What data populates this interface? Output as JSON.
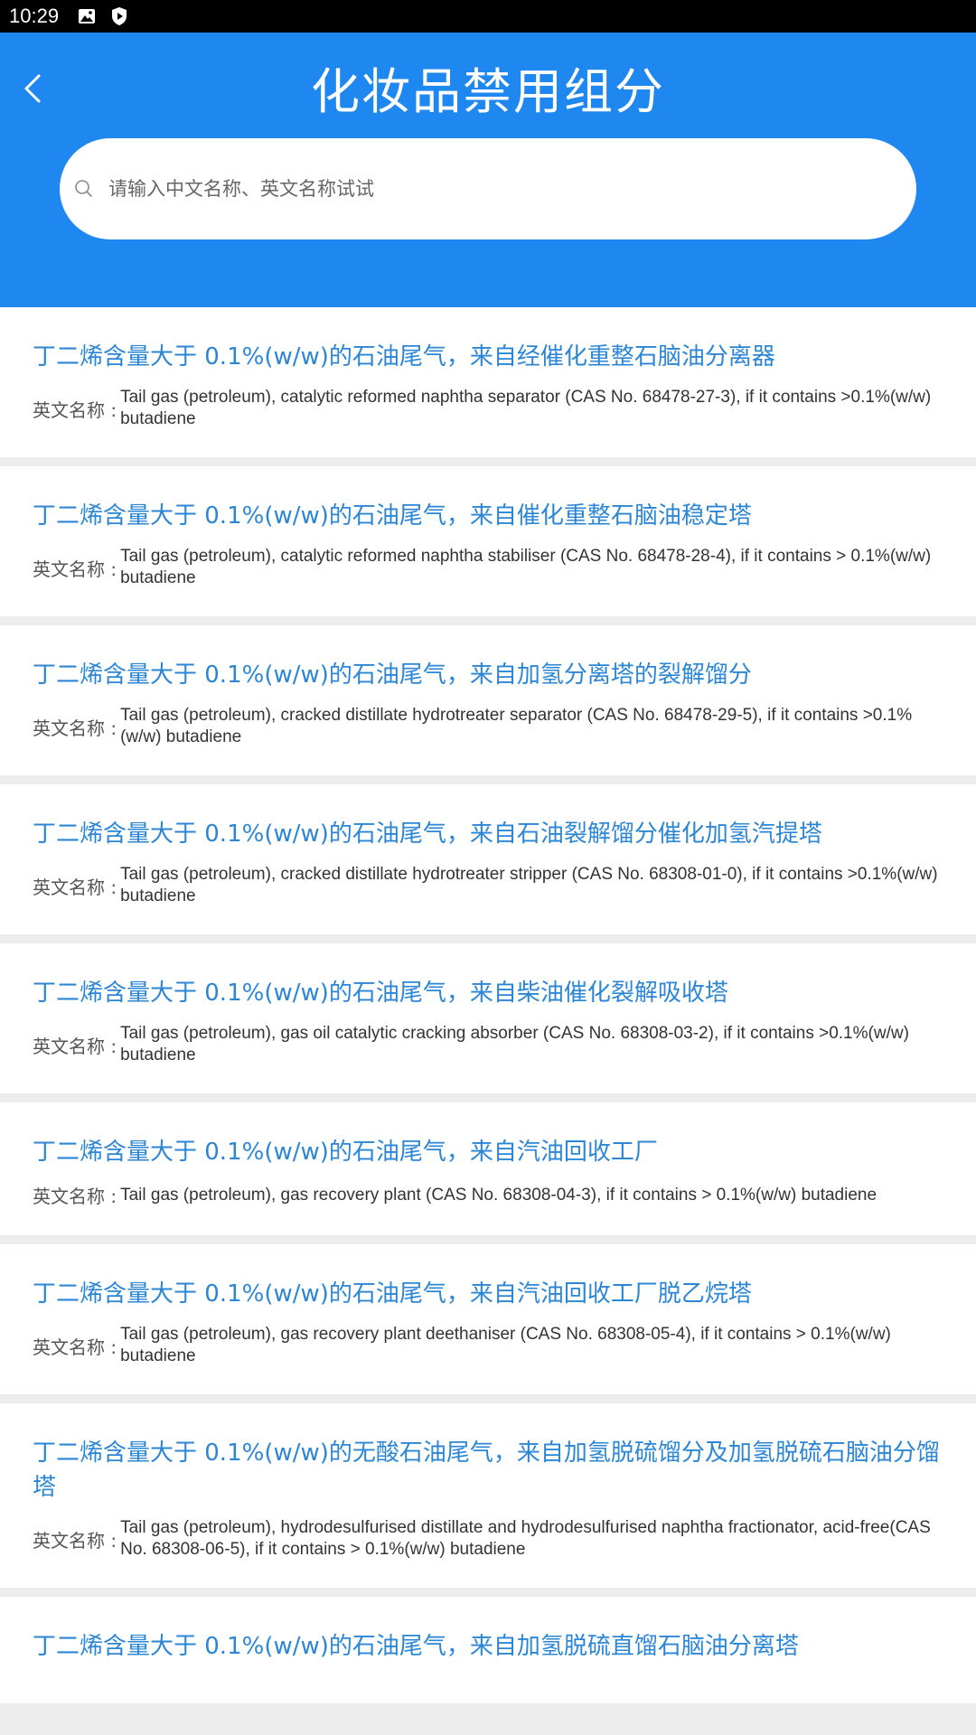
{
  "status_bar": {
    "time": "10:29",
    "icons": [
      "image-icon",
      "shield-play-icon"
    ]
  },
  "header": {
    "title": "化妆品禁用组分",
    "back_icon": "chevron-left-icon",
    "search": {
      "placeholder": "请输入中文名称、英文名称试试",
      "icon": "search-icon"
    }
  },
  "colors": {
    "primary": "#1e87f0",
    "title_link": "#2c86d6",
    "background": "#ededed"
  },
  "list": {
    "label": "英文名称 :",
    "items": [
      {
        "title": "丁二烯含量大于 0.1%(w/w)的石油尾气，来自经催化重整石脑油分离器",
        "english": "Tail gas (petroleum), catalytic reformed naphtha separator (CAS No. 68478-27-3), if it contains >0.1%(w/w) butadiene"
      },
      {
        "title": "丁二烯含量大于 0.1%(w/w)的石油尾气，来自催化重整石脑油稳定塔",
        "english": "Tail gas (petroleum), catalytic reformed naphtha stabiliser (CAS No. 68478-28-4), if it contains > 0.1%(w/w) butadiene"
      },
      {
        "title": "丁二烯含量大于 0.1%(w/w)的石油尾气，来自加氢分离塔的裂解馏分",
        "english": "Tail gas (petroleum), cracked distillate hydrotreater separator (CAS No. 68478-29-5), if it contains >0.1%(w/w) butadiene"
      },
      {
        "title": "丁二烯含量大于 0.1%(w/w)的石油尾气，来自石油裂解馏分催化加氢汽提塔",
        "english": "Tail gas (petroleum), cracked distillate hydrotreater stripper (CAS No. 68308-01-0), if it contains >0.1%(w/w) butadiene"
      },
      {
        "title": "丁二烯含量大于 0.1%(w/w)的石油尾气，来自柴油催化裂解吸收塔",
        "english": "Tail gas (petroleum), gas oil catalytic cracking absorber (CAS No. 68308-03-2), if it contains >0.1%(w/w) butadiene"
      },
      {
        "title": "丁二烯含量大于 0.1%(w/w)的石油尾气，来自汽油回收工厂",
        "english": "Tail gas (petroleum), gas recovery plant (CAS No. 68308-04-3), if it contains > 0.1%(w/w) butadiene"
      },
      {
        "title": "丁二烯含量大于 0.1%(w/w)的石油尾气，来自汽油回收工厂脱乙烷塔",
        "english": "Tail gas (petroleum), gas recovery plant deethaniser (CAS No. 68308-05-4), if it contains > 0.1%(w/w) butadiene"
      },
      {
        "title": "丁二烯含量大于 0.1%(w/w)的无酸石油尾气，来自加氢脱硫馏分及加氢脱硫石脑油分馏塔",
        "english": "Tail gas (petroleum), hydrodesulfurised distillate and hydrodesulfurised naphtha fractionator, acid-free(CAS No. 68308-06-5), if it contains > 0.1%(w/w) butadiene"
      },
      {
        "title": "丁二烯含量大于 0.1%(w/w)的石油尾气，来自加氢脱硫直馏石脑油分离塔",
        "english": ""
      }
    ]
  }
}
